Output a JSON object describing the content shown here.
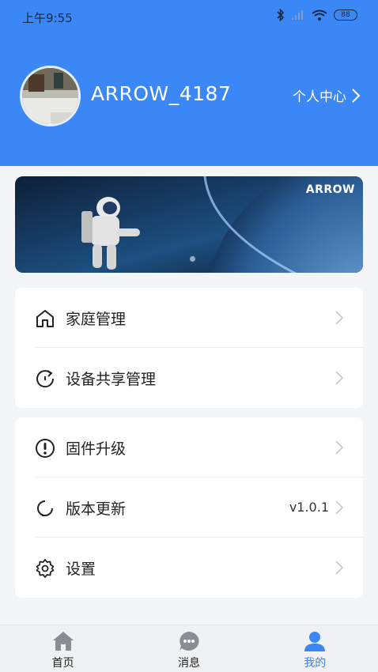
{
  "status_bar": {
    "time": "上午9:55",
    "battery": "88"
  },
  "profile": {
    "username": "ARROW_4187",
    "center_link": "个人中心"
  },
  "banner": {
    "logo": "ARROW"
  },
  "menu_group_1": {
    "items": [
      {
        "label": "家庭管理",
        "icon": "home-icon"
      },
      {
        "label": "设备共享管理",
        "icon": "share-icon"
      }
    ]
  },
  "menu_group_2": {
    "items": [
      {
        "label": "固件升级",
        "icon": "firmware-icon"
      },
      {
        "label": "版本更新",
        "icon": "refresh-icon",
        "value": "v1.0.1"
      },
      {
        "label": "设置",
        "icon": "gear-icon"
      }
    ]
  },
  "tabbar": {
    "tabs": [
      {
        "label": "首页",
        "icon": "home-icon"
      },
      {
        "label": "消息",
        "icon": "message-icon"
      },
      {
        "label": "我的",
        "icon": "user-icon",
        "active": true
      }
    ]
  },
  "colors": {
    "primary": "#3a87f5",
    "background": "#f4f5f7"
  }
}
